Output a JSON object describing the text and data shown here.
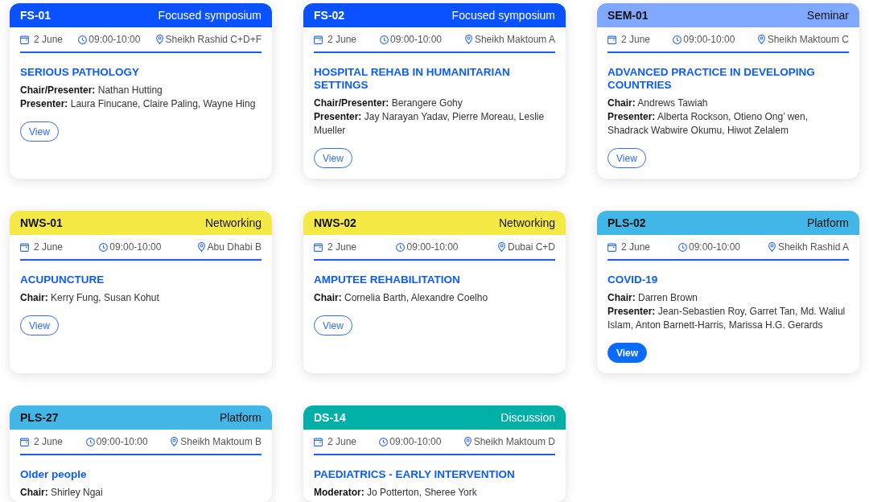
{
  "sessions": [
    {
      "code": "FS-01",
      "type": "Focused symposium",
      "color": "#0a52ff",
      "date": "2 June",
      "time": "09:00-10:00",
      "location": "Sheikh Rashid C+D+F",
      "title": "SERIOUS PATHOLOGY",
      "people": [
        "**Chair/Presenter:** Nathan Hutting",
        "**Presenter:** Laura Finucane, Claire Paling, Wayne Hing"
      ],
      "view": {
        "label": "View",
        "selected": false
      }
    },
    {
      "code": "FS-02",
      "type": "Focused symposium",
      "color": "#0a52ff",
      "date": "2 June",
      "time": "09:00-10:00",
      "location": "Sheikh Maktoum A",
      "title": "HOSPITAL REHAB IN HUMANITARIAN SETTINGS",
      "people": [
        "**Chair/Presenter:** Berangere Gohy",
        "**Presenter:** Jay Narayan Yadav, Pierre Moreau, Leslie Mueller"
      ],
      "view": {
        "label": "View",
        "selected": false
      }
    },
    {
      "code": "SEM-01",
      "type": "Seminar",
      "color": "#80a8ff",
      "date": "2 June",
      "time": "09:00-10:00",
      "location": "Sheikh Maktoum C",
      "title": "ADVANCED PRACTICE IN DEVELOPING COUNTRIES",
      "people": [
        "**Chair:** Andrews Tawiah",
        "**Presenter:** Alberta Rockson, Otieno Ong’ wen, Shadrack Wabwire Okumu, Hiwot Zelalem"
      ],
      "view": {
        "label": "View",
        "selected": false
      }
    },
    {
      "code": "NWS-01",
      "type": "Networking",
      "color": "#f5ea45",
      "date": "2 June",
      "time": "09:00-10:00",
      "location": "Abu Dhabi B",
      "title": "ACUPUNCTURE",
      "people": [
        "**Chair:** Kerry Fung, Susan Kohut"
      ],
      "view": {
        "label": "View",
        "selected": false
      }
    },
    {
      "code": "NWS-02",
      "type": "Networking",
      "color": "#f5ea45",
      "date": "2 June",
      "time": "09:00-10:00",
      "location": "Dubai C+D",
      "title": "AMPUTEE REHABILITATION",
      "people": [
        "**Chair:** Cornelia Barth, Alexandre Coelho"
      ],
      "view": {
        "label": "View",
        "selected": false
      }
    },
    {
      "code": "PLS-02",
      "type": "Platform",
      "color": "#42b6e6",
      "date": "2 June",
      "time": "09:00-10:00",
      "location": "Sheikh Rashid A",
      "title": "COVID-19",
      "people": [
        "**Chair:** Darren Brown",
        "**Presenter:** Jean-Sebastien Roy, Garret Tan, Md. Waliul Islam, Anton Barnett-Harris, Marissa H.G. Gerards"
      ],
      "view": {
        "label": "View",
        "selected": true
      }
    },
    {
      "code": "PLS-27",
      "type": "Platform",
      "color": "#42b6e6",
      "date": "2 June",
      "time": "09:00-10:00",
      "location": "Sheikh Maktoum B",
      "title": "Older people",
      "people": [
        "**Chair:** Shirley Ngai"
      ]
    },
    {
      "code": "DS-14",
      "type": "Discussion",
      "color": "#00b0a6",
      "date": "2 June",
      "time": "09:00-10:00",
      "location": "Sheikh Maktoum D",
      "title": "PAEDIATRICS - EARLY INTERVENTION",
      "people": [
        "**Moderator:** Jo Potterton, Sheree York"
      ]
    }
  ]
}
